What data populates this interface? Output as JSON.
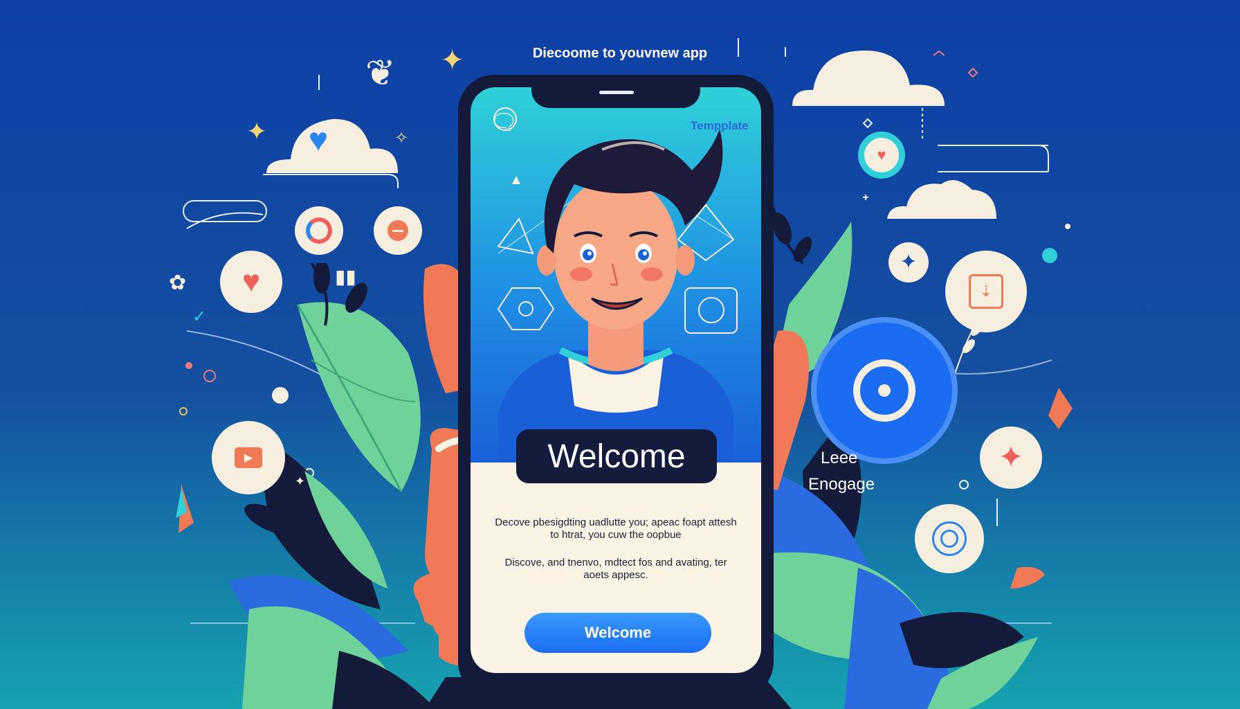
{
  "header": {
    "title": "Diecoome to youvnew app"
  },
  "screen": {
    "label": "Tempplate",
    "welcome_badge": "Welcome",
    "paragraph_1": "Decove pbesigdting uadlutte you; apeac foapt attesh to htrat, you cuw the oopbue",
    "paragraph_2": "Discove, and tnenvo, mdtect fos and avating, ter aoets appesc.",
    "cta_label": "Welcome"
  },
  "side_labels": {
    "line_1": "Leee",
    "line_2": "Enogage"
  },
  "icons": [
    "twitter-bird-icon",
    "sparkle-icon",
    "heart-icon",
    "chat-icon",
    "play-icon",
    "target-icon",
    "star-icon",
    "checkbox-icon",
    "share-icon",
    "camera-icon"
  ],
  "colors": {
    "background_top": "#0d3fa6",
    "background_bottom": "#16a3b0",
    "accent_blue": "#1b6cf0",
    "card_cream": "#fbf3e4",
    "heart_red": "#f0605a",
    "leaf_green": "#6fd29a"
  }
}
